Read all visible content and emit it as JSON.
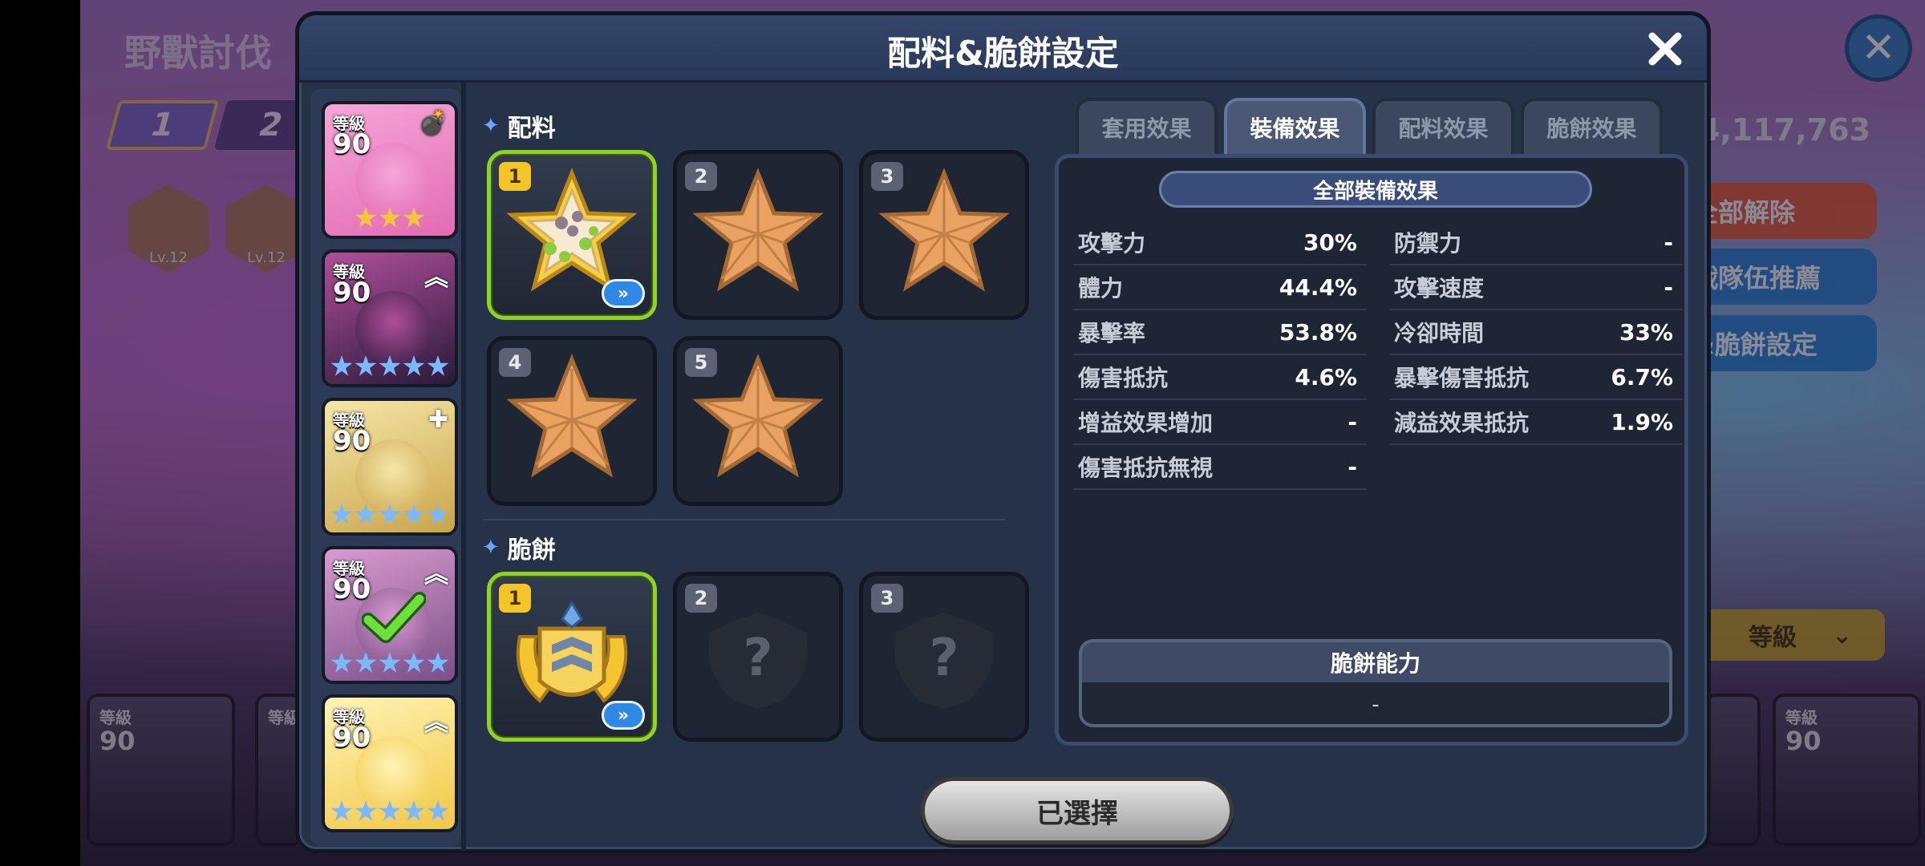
{
  "background": {
    "title": "野獸討伐",
    "team_tabs": [
      "1",
      "2"
    ],
    "team_power": "4,117,763",
    "skill_levels": [
      "Lv.12",
      "Lv.12"
    ],
    "buttons": {
      "unequip_all": "全部解除",
      "recommend": "戰隊伍推薦",
      "settings": "&脆餅設定"
    },
    "sort": {
      "label": "等級"
    },
    "bottom_cards": [
      {
        "level_label": "等級",
        "level": "90"
      },
      {
        "level_label": "等級",
        "level": ""
      },
      {
        "level_label": "等級",
        "level": "90"
      }
    ]
  },
  "modal": {
    "title": "配料&脆餅設定",
    "close_icon": "close-icon",
    "cookies": [
      {
        "level_label": "等級",
        "level": "90",
        "badge": "💣",
        "colors": [
          "#f6a6d8",
          "#e26bb3"
        ],
        "stars": 3,
        "star_color": "#f3c43d"
      },
      {
        "level_label": "等級",
        "level": "90",
        "badge": "︽",
        "colors": [
          "#b04f9a",
          "#2a1a3a"
        ],
        "stars": 5,
        "star_color": "#7ab8ff"
      },
      {
        "level_label": "等級",
        "level": "90",
        "badge": "✚",
        "colors": [
          "#f5e6a8",
          "#caa54a"
        ],
        "stars": 5,
        "star_color": "#7ab8ff"
      },
      {
        "level_label": "等級",
        "level": "90",
        "badge": "︽",
        "colors": [
          "#d89bd0",
          "#7a4f87"
        ],
        "stars": 5,
        "star_color": "#7ab8ff"
      },
      {
        "level_label": "等級",
        "level": "90",
        "badge": "︽",
        "colors": [
          "#fff3b6",
          "#f1c845"
        ],
        "stars": 5,
        "star_color": "#7ab8ff"
      }
    ],
    "toppings": {
      "label": "配料",
      "slots": [
        {
          "num": "1",
          "filled": true
        },
        {
          "num": "2",
          "filled": false
        },
        {
          "num": "3",
          "filled": false
        },
        {
          "num": "4",
          "filled": false
        },
        {
          "num": "5",
          "filled": false
        }
      ]
    },
    "tarts": {
      "label": "脆餅",
      "slots": [
        {
          "num": "1",
          "filled": true
        },
        {
          "num": "2",
          "filled": false,
          "unknown": "?"
        },
        {
          "num": "3",
          "filled": false,
          "unknown": "?"
        }
      ]
    },
    "upgrade_icon": "»",
    "tabs": [
      {
        "label": "套用效果",
        "active": false
      },
      {
        "label": "裝備效果",
        "active": true
      },
      {
        "label": "配料效果",
        "active": false
      },
      {
        "label": "脆餅效果",
        "active": false
      }
    ],
    "effects": {
      "header": "全部裝備效果",
      "rows": [
        [
          {
            "name": "攻擊力",
            "value": "30%"
          },
          {
            "name": "防禦力",
            "value": "-"
          }
        ],
        [
          {
            "name": "體力",
            "value": "44.4%"
          },
          {
            "name": "攻擊速度",
            "value": "-"
          }
        ],
        [
          {
            "name": "暴擊率",
            "value": "53.8%"
          },
          {
            "name": "冷卻時間",
            "value": "33%"
          }
        ],
        [
          {
            "name": "傷害抵抗",
            "value": "4.6%"
          },
          {
            "name": "暴擊傷害抵抗",
            "value": "6.7%"
          }
        ],
        [
          {
            "name": "增益效果增加",
            "value": "-"
          },
          {
            "name": "減益效果抵抗",
            "value": "1.9%"
          }
        ],
        [
          {
            "name": "傷害抵抗無視",
            "value": "-"
          }
        ]
      ]
    },
    "tart_ability": {
      "title": "脆餅能力",
      "value": "-"
    },
    "selected_button": "已選擇",
    "colors": {
      "active_slot": "#8fd424",
      "slot_number_active": "#f3c526",
      "accent_blue": "#2f88e6"
    }
  }
}
